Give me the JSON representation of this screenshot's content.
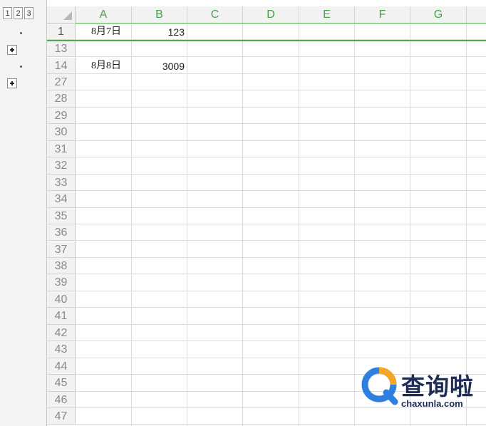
{
  "outline": {
    "levels": [
      "1",
      "2",
      "3"
    ]
  },
  "columns": [
    "A",
    "B",
    "C",
    "D",
    "E",
    "F",
    "G"
  ],
  "rows": [
    {
      "num": "1",
      "a": "8月7日",
      "b": "123"
    },
    {
      "num": "13",
      "a": "",
      "b": ""
    },
    {
      "num": "14",
      "a": "8月8日",
      "b": "3009"
    },
    {
      "num": "27",
      "a": "",
      "b": ""
    },
    {
      "num": "28",
      "a": "",
      "b": ""
    },
    {
      "num": "29",
      "a": "",
      "b": ""
    },
    {
      "num": "30",
      "a": "",
      "b": ""
    },
    {
      "num": "31",
      "a": "",
      "b": ""
    },
    {
      "num": "32",
      "a": "",
      "b": ""
    },
    {
      "num": "33",
      "a": "",
      "b": ""
    },
    {
      "num": "34",
      "a": "",
      "b": ""
    },
    {
      "num": "35",
      "a": "",
      "b": ""
    },
    {
      "num": "36",
      "a": "",
      "b": ""
    },
    {
      "num": "37",
      "a": "",
      "b": ""
    },
    {
      "num": "38",
      "a": "",
      "b": ""
    },
    {
      "num": "39",
      "a": "",
      "b": ""
    },
    {
      "num": "40",
      "a": "",
      "b": ""
    },
    {
      "num": "41",
      "a": "",
      "b": ""
    },
    {
      "num": "42",
      "a": "",
      "b": ""
    },
    {
      "num": "43",
      "a": "",
      "b": ""
    },
    {
      "num": "44",
      "a": "",
      "b": ""
    },
    {
      "num": "45",
      "a": "",
      "b": ""
    },
    {
      "num": "46",
      "a": "",
      "b": ""
    },
    {
      "num": "47",
      "a": "",
      "b": ""
    }
  ],
  "watermark": {
    "brand": "查询啦",
    "url": "chaxunla.com",
    "icon": "magnifier-q-icon"
  },
  "colors": {
    "header_text": "#47a04a",
    "selection_line": "#4caa4f",
    "watermark_orange": "#f5a623",
    "watermark_blue": "#2f7fe0"
  }
}
